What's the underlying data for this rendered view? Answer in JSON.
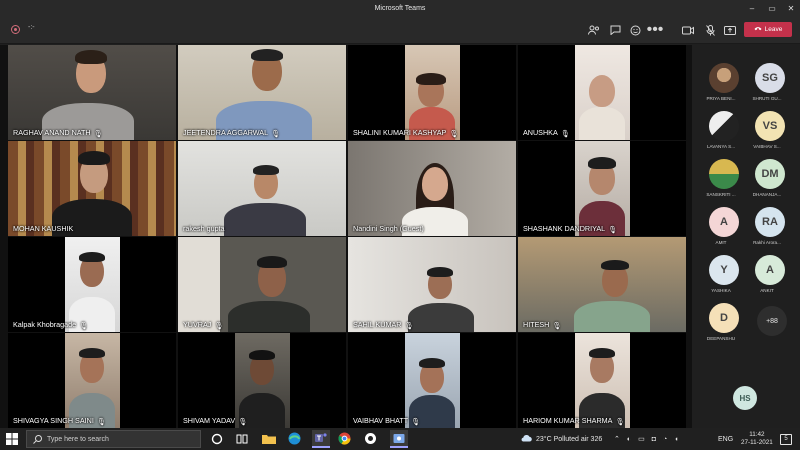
{
  "window": {
    "title": "Microsoft Teams"
  },
  "meeting": {
    "timer": "-:-",
    "leave_label": "Leave"
  },
  "participants": [
    {
      "name": "RAGHAV ANAND NATH",
      "muted": true
    },
    {
      "name": "JEETENDRA AGGARWAL",
      "muted": true
    },
    {
      "name": "SHALINI KUMARI KASHYAP",
      "muted": true
    },
    {
      "name": "ANUSHKA",
      "muted": true
    },
    {
      "name": "MOHAN KAUSHIK",
      "muted": false
    },
    {
      "name": "rakesh gupta",
      "muted": false
    },
    {
      "name": "Nandini Singh (Guest)",
      "muted": false
    },
    {
      "name": "SHASHANK  DANDRIYAL",
      "muted": true
    },
    {
      "name": "Kalpak Khobragade",
      "muted": true
    },
    {
      "name": "YUVRAJ",
      "muted": true
    },
    {
      "name": "SAHIL KUMAR",
      "muted": true
    },
    {
      "name": "HITESH",
      "muted": true
    },
    {
      "name": "SHIVAGYA SINGH SAINI",
      "muted": true
    },
    {
      "name": "SHIVAM  YADAV",
      "muted": true
    },
    {
      "name": "VAIBHAV BHATT",
      "muted": true
    },
    {
      "name": "HARIOM KUMAR SHARMA",
      "muted": true
    }
  ],
  "rail": [
    {
      "initials": "",
      "name": "PRIYA BENI...",
      "color": "#7a5a40"
    },
    {
      "initials": "SG",
      "name": "SHRUTI GU...",
      "color": "#d9dde8"
    },
    {
      "initials": "",
      "name": "LAVANYA S...",
      "color": "#3a3a3a"
    },
    {
      "initials": "VS",
      "name": "VAIBHAV S...",
      "color": "#f2e3b3"
    },
    {
      "initials": "",
      "name": "SANSKRITI ...",
      "color": "#d8b850"
    },
    {
      "initials": "DM",
      "name": "DHANANJA...",
      "color": "#cfe7cf"
    },
    {
      "initials": "A",
      "name": "AMIT",
      "color": "#f4d6d6"
    },
    {
      "initials": "RA",
      "name": "Rakhi Arora...",
      "color": "#d5e4ee"
    },
    {
      "initials": "Y",
      "name": "YASHIKA",
      "color": "#dbe6ee"
    },
    {
      "initials": "A",
      "name": "ANKIT",
      "color": "#d7ead9"
    },
    {
      "initials": "D",
      "name": "DEEPANSHU",
      "color": "#f5e0b8"
    }
  ],
  "more_count": "+88",
  "self_view": {
    "initials": "HS"
  },
  "taskbar": {
    "search_placeholder": "Type here to search",
    "weather": "23°C  Polluted air 326",
    "language": "ENG",
    "time": "11:42",
    "date": "27-11-2021",
    "notification_count": "5"
  },
  "colors": {
    "accent": "#6264a7",
    "leave": "#c4314b",
    "chrome": "#292929"
  }
}
